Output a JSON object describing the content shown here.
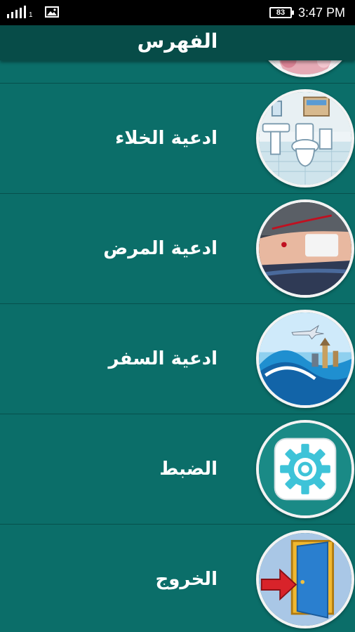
{
  "status_bar": {
    "signal_label": "1",
    "battery": "83",
    "time": "3:47 PM"
  },
  "header": {
    "title": "الفهرس"
  },
  "menu": {
    "items": [
      {
        "label": "ادعية الخلاء",
        "icon": "bathroom-icon"
      },
      {
        "label": "ادعية المرض",
        "icon": "iv-drip-icon"
      },
      {
        "label": "ادعية السفر",
        "icon": "travel-icon"
      },
      {
        "label": "الضبط",
        "icon": "gear-icon"
      },
      {
        "label": "الخروج",
        "icon": "exit-door-icon"
      }
    ]
  },
  "colors": {
    "background": "#0b6e69",
    "app_bar": "#074c48",
    "text": "#ffffff"
  }
}
